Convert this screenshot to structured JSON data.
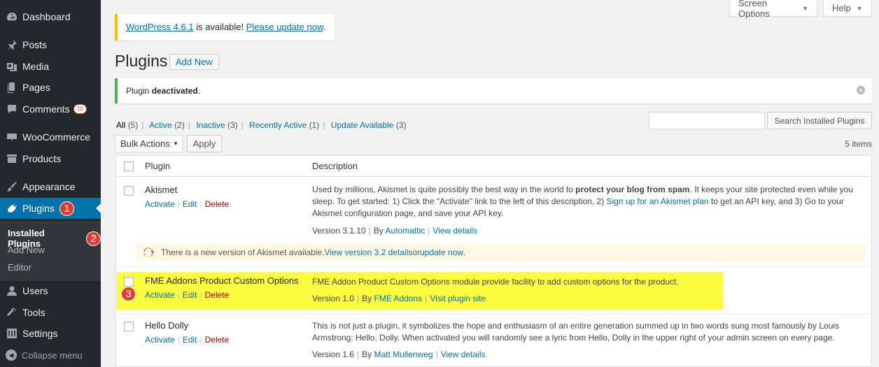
{
  "sidebar": {
    "menu": [
      {
        "id": "dashboard",
        "label": "Dashboard",
        "icon": "dashboard-icon"
      },
      {
        "id": "posts",
        "label": "Posts",
        "icon": "pin-icon"
      },
      {
        "id": "media",
        "label": "Media",
        "icon": "media-icon"
      },
      {
        "id": "pages",
        "label": "Pages",
        "icon": "pages-icon"
      },
      {
        "id": "comments",
        "label": "Comments",
        "icon": "comment-icon",
        "badge": "10"
      },
      {
        "id": "woocommerce",
        "label": "WooCommerce",
        "icon": "woo-icon"
      },
      {
        "id": "products",
        "label": "Products",
        "icon": "archive-icon"
      },
      {
        "id": "appearance",
        "label": "Appearance",
        "icon": "brush-icon"
      },
      {
        "id": "plugins",
        "label": "Plugins",
        "icon": "plugin-icon",
        "marker": "1"
      },
      {
        "id": "users",
        "label": "Users",
        "icon": "user-icon"
      },
      {
        "id": "tools",
        "label": "Tools",
        "icon": "wrench-icon"
      },
      {
        "id": "settings",
        "label": "Settings",
        "icon": "settings-icon"
      }
    ],
    "submenu": [
      {
        "label": "Installed Plugins",
        "marker": "2"
      },
      {
        "label": "Add New"
      },
      {
        "label": "Editor"
      }
    ],
    "collapse_label": "Collapse menu"
  },
  "topbar": {
    "screen_options": "Screen Options",
    "help": "Help"
  },
  "update_nag": {
    "version_link": "WordPress 4.6.1",
    "middle": " is available! ",
    "update_link": "Please update now",
    "end": "."
  },
  "page": {
    "title": "Plugins",
    "add_new": "Add New"
  },
  "notice": {
    "prefix": "Plugin ",
    "bold": "deactivated",
    "suffix": "."
  },
  "filters": [
    {
      "label": "All",
      "count": "(5)",
      "current": true
    },
    {
      "label": "Active",
      "count": "(2)"
    },
    {
      "label": "Inactive",
      "count": "(3)"
    },
    {
      "label": "Recently Active",
      "count": "(1)"
    },
    {
      "label": "Update Available",
      "count": "(3)"
    }
  ],
  "search": {
    "placeholder": "",
    "button": "Search Installed Plugins"
  },
  "bulk": {
    "selected": "Bulk Actions",
    "apply": "Apply",
    "items_count": "5 items"
  },
  "table": {
    "col_plugin": "Plugin",
    "col_description": "Description",
    "rows": [
      {
        "name": "Akismet",
        "actions": [
          "Activate",
          "Edit",
          "Delete"
        ],
        "desc_parts": {
          "a": "Used by millions, Akismet is quite possibly the best way in the world to ",
          "bold": "protect your blog from spam",
          "b": ". It keeps your site protected even while you sleep. To get started: 1) Click the \"Activate\" link to the left of this description, 2) ",
          "link": "Sign up for an Akismet plan",
          "c": " to get an API key, and 3) Go to your Akismet configuration page, and save your API key."
        },
        "version": "Version 3.1.10",
        "by": "By ",
        "author": "Automattic",
        "details": "View details",
        "update": {
          "text": "There is a new version of Akismet available. ",
          "link1": "View version 3.2 details",
          "mid": " or ",
          "link2": "update now",
          "end": "."
        }
      },
      {
        "name": "FME Addons Product Custom Options",
        "actions": [
          "Activate",
          "Edit",
          "Delete"
        ],
        "description": "FME Addon Product Custom Options module provide facility to add custom options for the product.",
        "version": "Version 1.0",
        "by": "By ",
        "author": "FME Addons",
        "details": "Visit plugin site",
        "marker": "3"
      },
      {
        "name": "Hello Dolly",
        "actions": [
          "Activate",
          "Edit",
          "Delete"
        ],
        "description": "This is not just a plugin, it symbolizes the hope and enthusiasm of an entire generation summed up in two words sung most famously by Louis Armstrong: Hello, Dolly. When activated you will randomly see a lyric from Hello, Dolly in the upper right of your admin screen on every page.",
        "version": "Version 1.6",
        "by": "By ",
        "author": "Matt Mullenweg",
        "details": "View details"
      }
    ]
  },
  "colors": {
    "sidebar_bg": "#23282d",
    "active_blue": "#0073aa",
    "highlight_yellow": "#fbfb3f",
    "marker_red": "#e03c31",
    "delete_red": "#a00"
  }
}
